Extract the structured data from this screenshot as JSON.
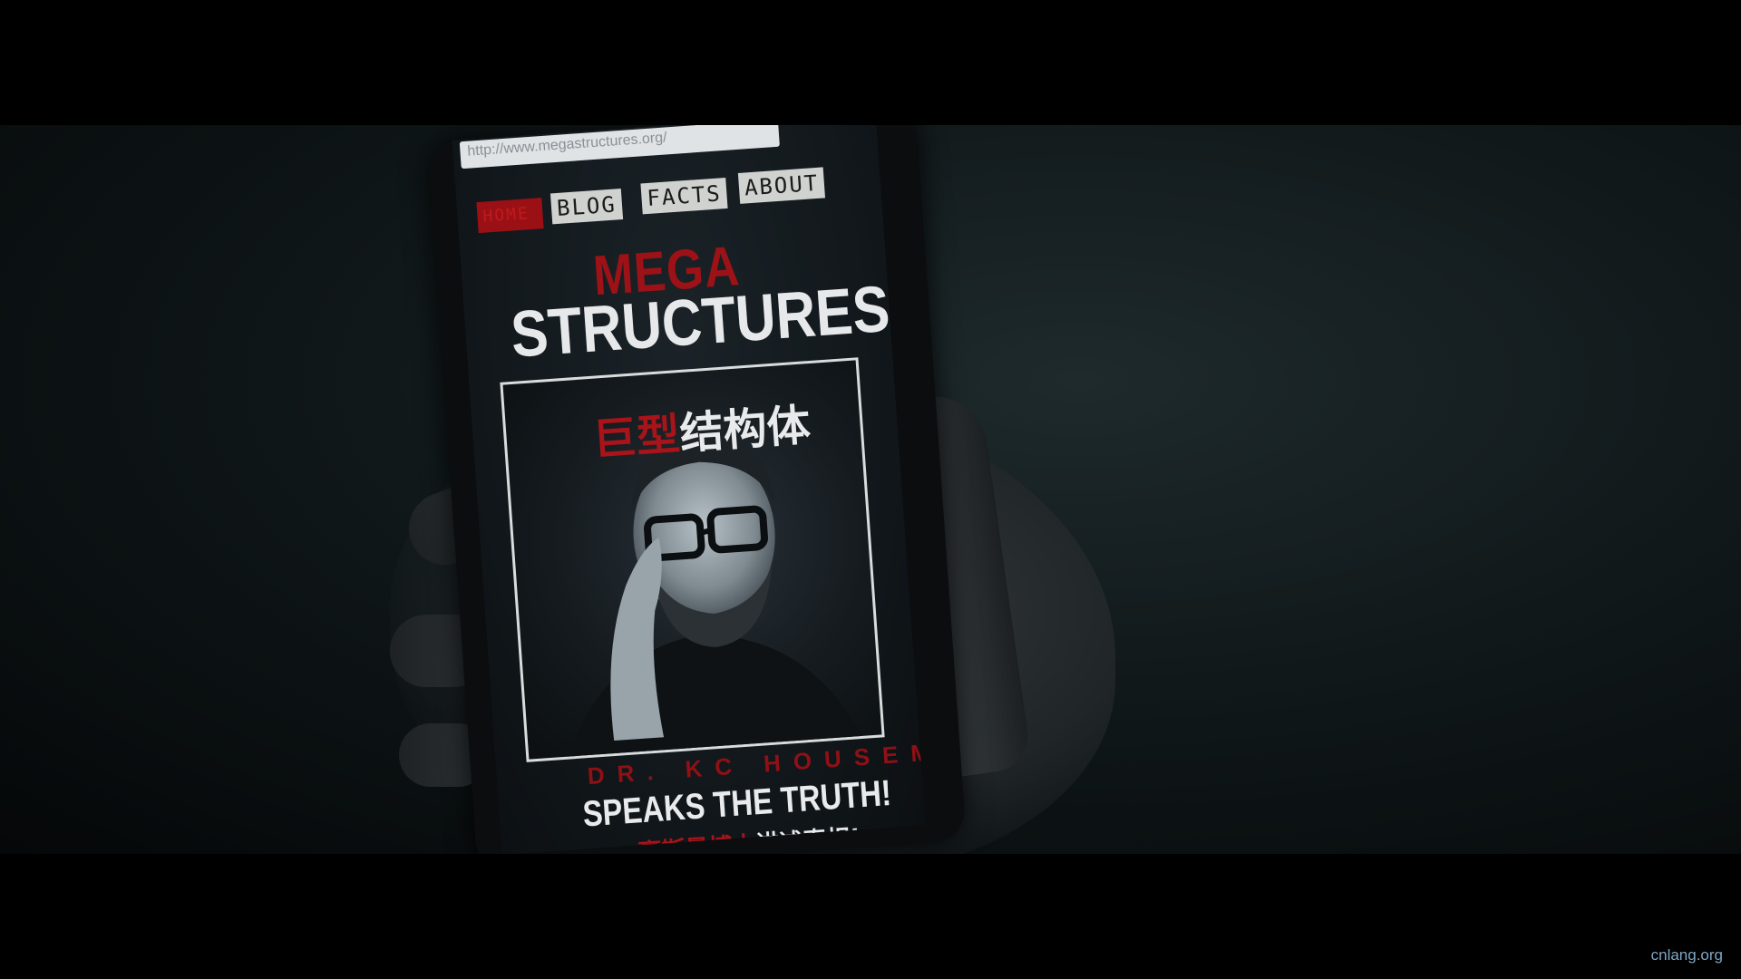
{
  "browser": {
    "url": "http://www.megastructures.org/"
  },
  "nav": {
    "home_label": "HOME",
    "blog_label": "BLOG",
    "facts_label": "FACTS",
    "about_label": "ABOUT"
  },
  "site": {
    "title_line1": "MEGA",
    "title_line2": "STRUCTURES",
    "cn_title_red": "巨型",
    "cn_title_white": "结构体",
    "subtitle_name": "DR. KC HOUSEMAN",
    "subtitle_tagline": "SPEAKS THE TRUTH!",
    "subtitle_cn_red": "豪斯曼博士",
    "subtitle_cn_white": "讲述真相!"
  },
  "watermark": "cnlang.org",
  "colors": {
    "accent_red": "#9c1217",
    "title_white": "#e6e8ea"
  }
}
